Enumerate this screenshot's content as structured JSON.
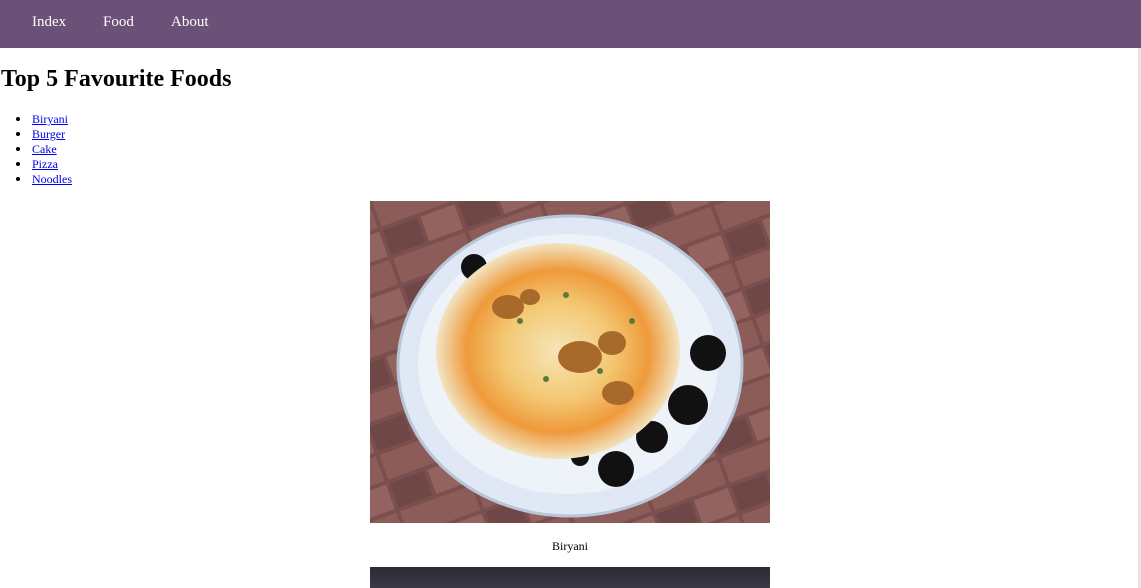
{
  "nav": {
    "items": [
      {
        "label": "Index"
      },
      {
        "label": "Food"
      },
      {
        "label": "About"
      }
    ]
  },
  "page": {
    "title": "Top 5 Favourite Foods"
  },
  "food_list": {
    "items": [
      "Biryani",
      "Burger",
      "Cake",
      "Pizza",
      "Noodles"
    ]
  },
  "gallery": {
    "first": {
      "caption": "Biryani",
      "image": "biryani-plate"
    },
    "second": {
      "image": "next-food-photo"
    }
  },
  "colors": {
    "navbar": "#6b5078",
    "link": "#0000ee"
  }
}
